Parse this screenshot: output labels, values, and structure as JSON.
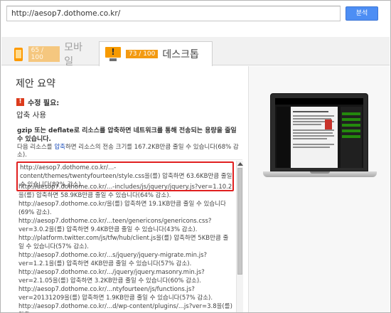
{
  "url_bar": {
    "value": "http://aesop7.dothome.co.kr/",
    "analyze_label": "분석"
  },
  "tabs": {
    "mobile": {
      "score": "65 / 100",
      "label": "모바일"
    },
    "desktop": {
      "score": "73 / 100",
      "label": "데스크톱"
    }
  },
  "summary": {
    "heading": "제안 요약",
    "required_label": "수정 필요:",
    "rule_title": "압축 사용",
    "description_bold": "gzip 또는 deflate로 리소스를 압축하면 네트워크를 통해 전송되는 용량을 줄일 수 있습니다.",
    "description_pre": "다음 리소스를 ",
    "description_link": "압축",
    "description_post": "하면 리소스의 전송 크기를 167.2KB만큼 줄일 수 있습니다(68% 감소).",
    "resources": [
      "http://aesop7.dothome.co.kr/...-content/themes/twentyfourteen/style.css을(를) 압축하면 63.6KB만큼 줄일 수 있습니다(82% 감소).",
      "http://aesop7.dothome.co.kr/...-includes/js/jquery/jquery.js?ver=1.10.2을(를) 압축하면 58.9KB만큼 줄일 수 있습니다(64% 감소).",
      "http://aesop7.dothome.co.kr/을(를) 압축하면 19.1KB만큼 줄일 수 있습니다(69% 감소).",
      "http://aesop7.dothome.co.kr/...teen/genericons/genericons.css?ver=3.0.2을(를) 압축하면 9.4KB만큼 줄일 수 있습니다(43% 감소).",
      "http://platform.twitter.com/js/tfw/hub/client.js을(를) 압축하면 5KB만큼 줄일 수 있습니다(57% 감소).",
      "http://aesop7.dothome.co.kr/...s/jquery/jquery-migrate.min.js?ver=1.2.1을(를) 압축하면 4KB만큼 줄일 수 있습니다(57% 감소).",
      "http://aesop7.dothome.co.kr/.../jquery/jquery.masonry.min.js?ver=2.1.05을(를) 압축하면 3.2KB만큼 줄일 수 있습니다(60% 감소).",
      "http://aesop7.dothome.co.kr/...ntyfourteen/js/functions.js?ver=20131209을(를) 압축하면 1.9KB만큼 줄일 수 있습니다(57% 감소).",
      "http://aesop7.dothome.co.kr/...d/wp-content/plugins/...js?ver=3.8을(를) 압축"
    ]
  }
}
